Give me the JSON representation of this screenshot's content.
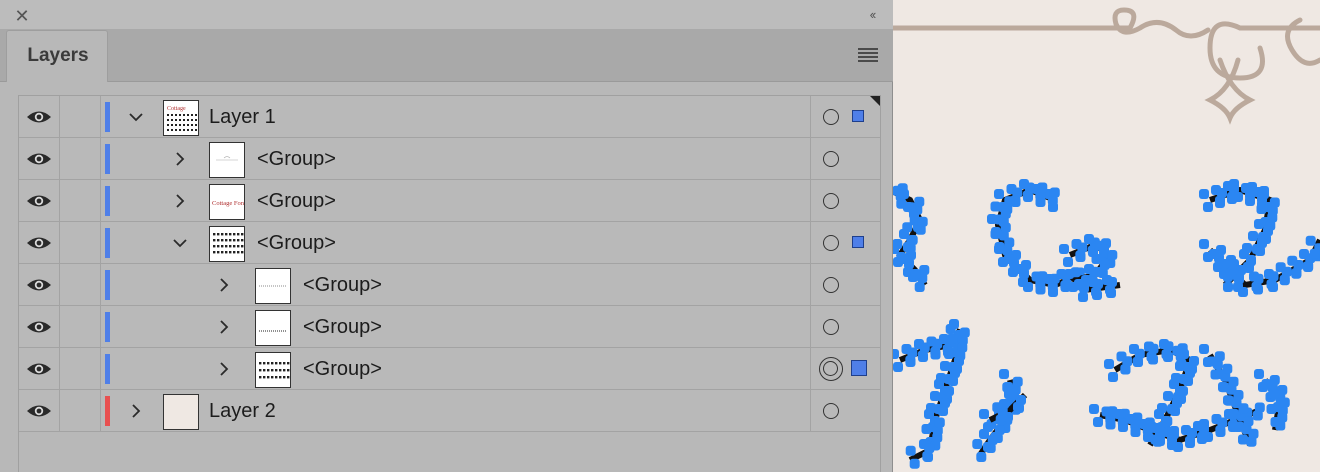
{
  "panel": {
    "tab_label": "Layers",
    "close_icon": "close-icon",
    "collapse_icon": "double-chevron-left-icon",
    "menu_icon": "hamburger-menu-icon"
  },
  "colors": {
    "layer1": "#4f7fe8",
    "layer2": "#e85050",
    "selection": "#4f7fe8",
    "art_blue": "#2b86f2"
  },
  "rows": [
    {
      "label": "Layer 1",
      "level": 0,
      "expanded": true,
      "color": "#4f7fe8",
      "target": "circle",
      "selected": "small"
    },
    {
      "label": "<Group>",
      "level": 1,
      "expanded": false,
      "color": "#4f7fe8",
      "target": "circle",
      "selected": "none"
    },
    {
      "label": "<Group>",
      "level": 1,
      "expanded": false,
      "color": "#4f7fe8",
      "target": "circle",
      "selected": "none"
    },
    {
      "label": "<Group>",
      "level": 1,
      "expanded": true,
      "color": "#4f7fe8",
      "target": "circle",
      "selected": "small"
    },
    {
      "label": "<Group>",
      "level": 2,
      "expanded": false,
      "color": "#4f7fe8",
      "target": "circle",
      "selected": "none"
    },
    {
      "label": "<Group>",
      "level": 2,
      "expanded": false,
      "color": "#4f7fe8",
      "target": "circle",
      "selected": "none"
    },
    {
      "label": "<Group>",
      "level": 2,
      "expanded": false,
      "color": "#4f7fe8",
      "target": "double-circle",
      "selected": "big"
    },
    {
      "label": "Layer 2",
      "level": 0,
      "expanded": false,
      "color": "#e85050",
      "target": "circle",
      "selected": "none"
    }
  ]
}
